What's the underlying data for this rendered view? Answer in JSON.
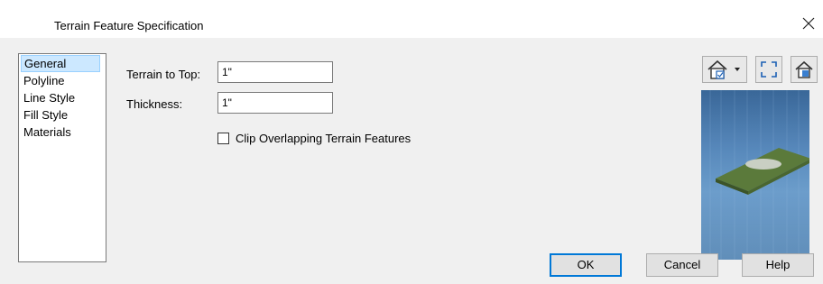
{
  "window": {
    "title": "Terrain Feature Specification"
  },
  "nav": {
    "items": [
      {
        "label": "General",
        "selected": true
      },
      {
        "label": "Polyline",
        "selected": false
      },
      {
        "label": "Line Style",
        "selected": false
      },
      {
        "label": "Fill Style",
        "selected": false
      },
      {
        "label": "Materials",
        "selected": false
      }
    ]
  },
  "general": {
    "terrain_to_top_label": "Terrain to Top:",
    "terrain_to_top_value": "1\"",
    "thickness_label": "Thickness:",
    "thickness_value": "1\"",
    "clip_label": "Clip Overlapping Terrain Features",
    "clip_checked": false
  },
  "preview": {
    "tools": [
      "camera-view-dropdown-icon",
      "fit-to-window-icon",
      "render-preview-icon"
    ],
    "background_color": "#4a7fb6",
    "surface_color": "#5a7a3a"
  },
  "buttons": {
    "ok": "OK",
    "cancel": "Cancel",
    "help": "Help"
  },
  "colors": {
    "accent": "#0078d7",
    "selection": "#cce8ff"
  }
}
